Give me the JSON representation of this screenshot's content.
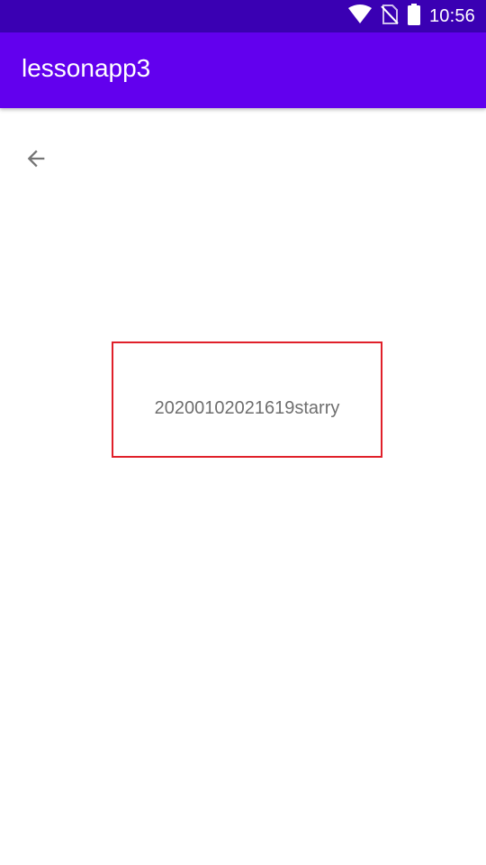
{
  "status_bar": {
    "time": "10:56",
    "icons": [
      "wifi-icon",
      "no-sim-icon",
      "battery-icon"
    ],
    "background_color": "#3a00b3"
  },
  "app_bar": {
    "title": "lessonapp3",
    "background_color": "#6200ee"
  },
  "navigation": {
    "back_icon": "arrow-back-icon"
  },
  "content": {
    "text": "20200102021619starry",
    "border_color": "#e0202a",
    "text_color": "#6e6e6e"
  }
}
